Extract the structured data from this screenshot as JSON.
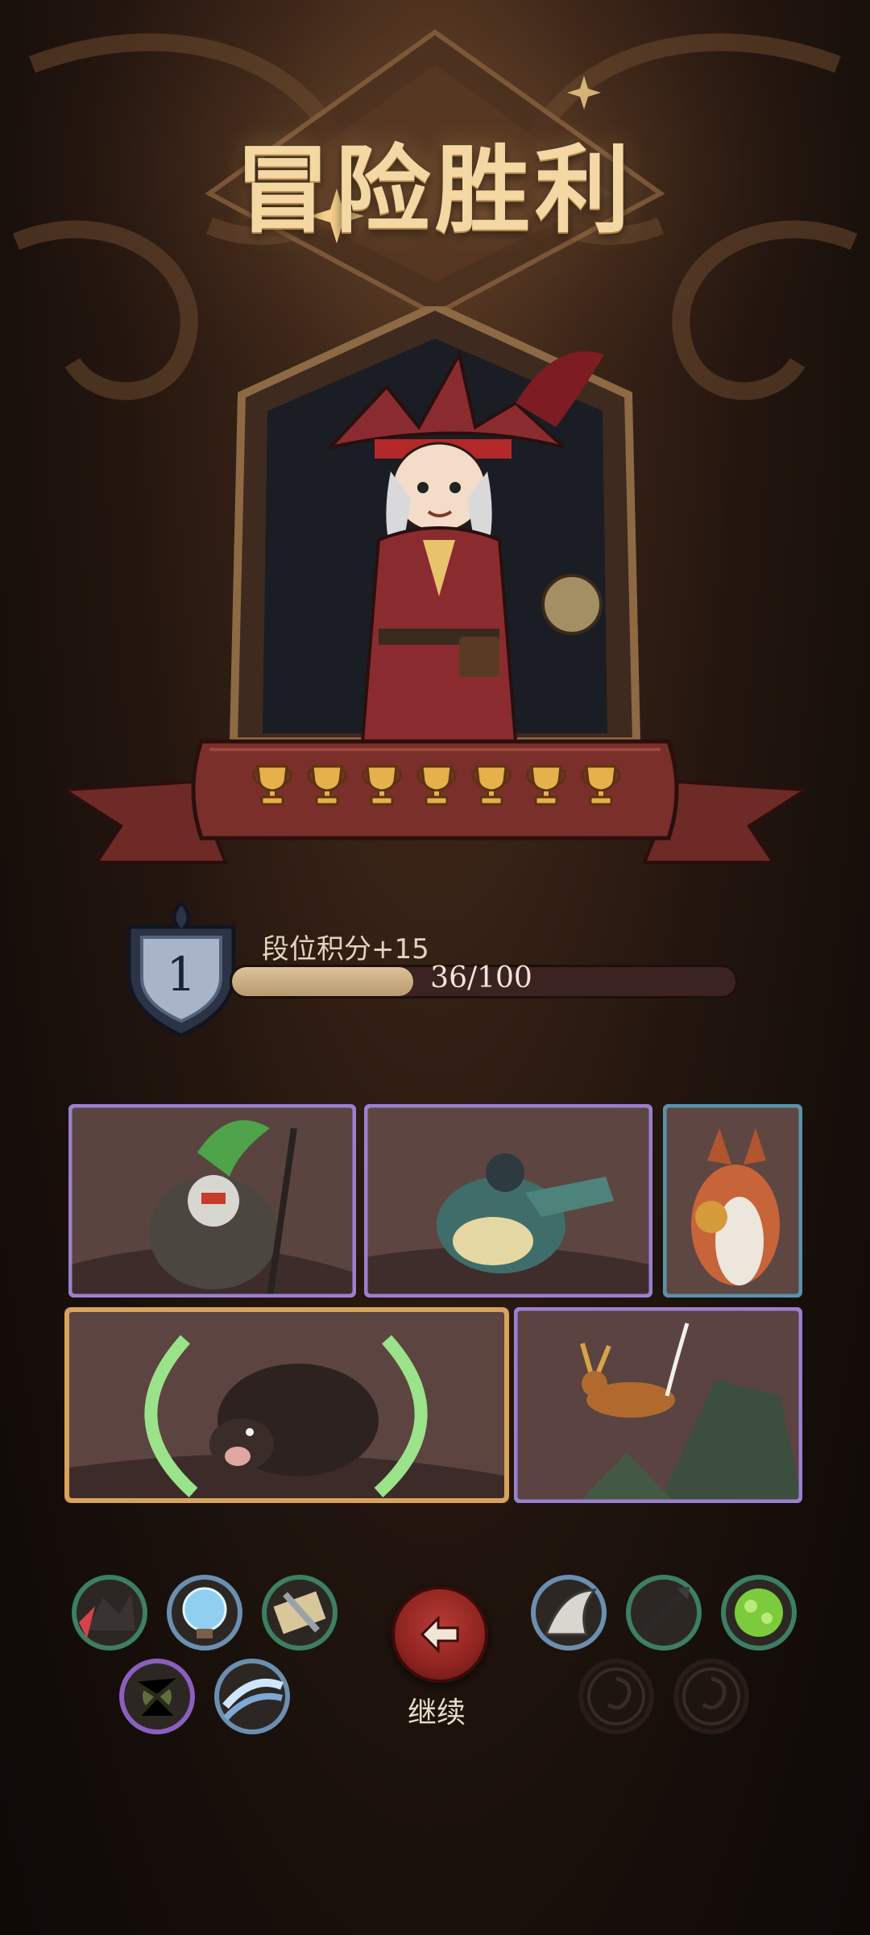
{
  "title": "冒险胜利",
  "trophies": {
    "count": 7,
    "icon": "trophy-icon",
    "color": "#e6b04b"
  },
  "rank": {
    "level": "1",
    "points_label": "段位积分+15",
    "progress_text": "36/100",
    "progress_value": 0.36
  },
  "cards": [
    {
      "name": "shaman-bird-card",
      "rarity": "epic",
      "border_color": "#9c7fd0"
    },
    {
      "name": "armored-crocodile-card",
      "rarity": "epic",
      "border_color": "#9c7fd0"
    },
    {
      "name": "fox-card",
      "rarity": "rare",
      "border_color": "#5a93a8"
    },
    {
      "name": "wild-boar-card",
      "rarity": "legendary",
      "border_color": "#d8a35c"
    },
    {
      "name": "deer-card",
      "rarity": "epic",
      "border_color": "#9c7fd0"
    }
  ],
  "skills_left": [
    {
      "icon": "rage-beast-icon",
      "ring": "#3c7f63"
    },
    {
      "icon": "crystal-orb-icon",
      "ring": "#6b8fb0"
    },
    {
      "icon": "scroll-blade-icon",
      "ring": "#3c7f63"
    },
    {
      "icon": "thorn-trap-icon",
      "ring": "#8a5fbe"
    },
    {
      "icon": "wind-slash-icon",
      "ring": "#6b8fb0"
    }
  ],
  "skills_right": [
    {
      "icon": "shark-fin-icon",
      "ring": "#6b8fb0",
      "locked": false
    },
    {
      "icon": "spear-icon",
      "ring": "#3c7f63",
      "locked": false
    },
    {
      "icon": "green-egg-icon",
      "ring": "#3c7f63",
      "locked": false
    },
    {
      "icon": "empty-slot-icon",
      "locked": true
    },
    {
      "icon": "empty-slot-icon",
      "locked": true
    }
  ],
  "continue": {
    "label": "继续",
    "icon": "arrow-left-icon"
  }
}
